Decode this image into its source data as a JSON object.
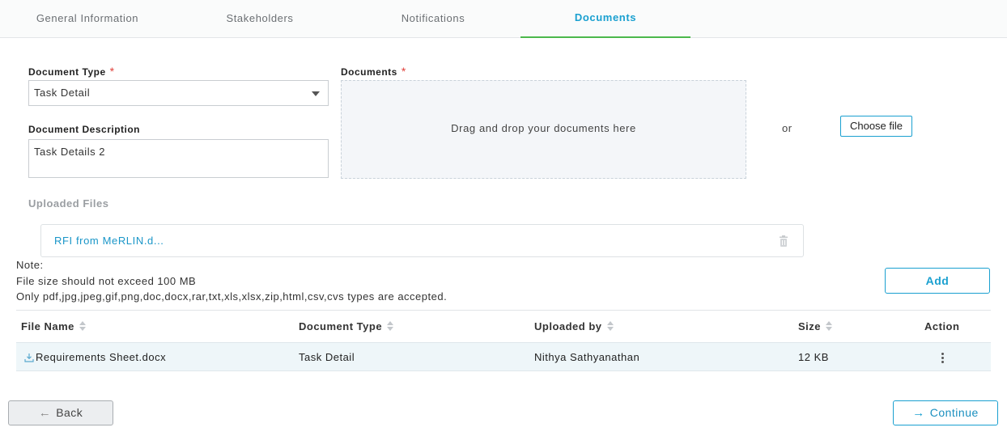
{
  "tabs": [
    {
      "label": "General Information"
    },
    {
      "label": "Stakeholders"
    },
    {
      "label": "Notifications"
    },
    {
      "label": "Documents",
      "active": true
    }
  ],
  "form": {
    "document_type_label": "Document Type",
    "document_type_value": "Task Detail",
    "document_description_label": "Document Description",
    "document_description_value": "Task Details 2",
    "documents_label": "Documents",
    "required_mark": "*",
    "dropzone_text": "Drag and drop your documents here",
    "or_text": "or",
    "choose_file_label": "Choose file"
  },
  "uploaded": {
    "title": "Uploaded Files",
    "files": [
      "RFI from MeRLIN.d..."
    ]
  },
  "note": {
    "heading": "Note:",
    "size_limit": "File size should not exceed 100 MB",
    "types": "Only pdf,jpg,jpeg,gif,png,doc,docx,rar,txt,xls,xlsx,zip,html,csv,cvs types are accepted."
  },
  "add_label": "Add",
  "table": {
    "headers": [
      "File Name",
      "Document Type",
      "Uploaded by",
      "Size",
      "Action"
    ],
    "rows": [
      {
        "file_name": "Requirements Sheet.docx",
        "document_type": "Task Detail",
        "uploaded_by": "Nithya Sathyanathan",
        "size": "12 KB"
      }
    ]
  },
  "footer": {
    "back_label": "Back",
    "continue_label": "Continue"
  },
  "colors": {
    "accent": "#1aa0d0",
    "active_tab_underline": "#4bb84b",
    "required": "#e0403a"
  }
}
